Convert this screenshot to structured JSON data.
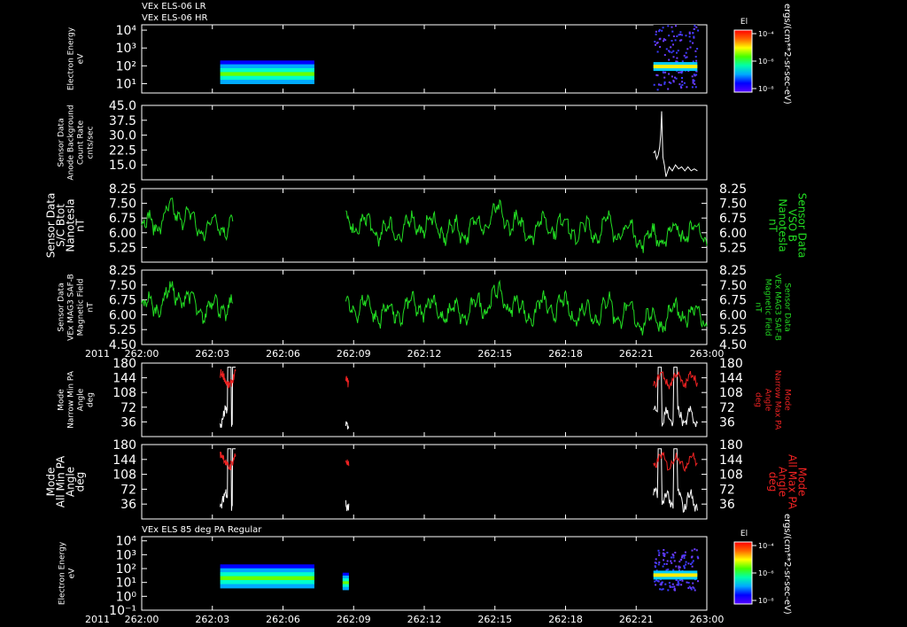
{
  "header": {
    "line1": "VEx ELS-06 LR",
    "line2": "VEx ELS-06 HR",
    "bottom_title": "VEx ELS 85 deg PA Regular"
  },
  "colors": {
    "white": "#ffffff",
    "green": "#22dd22",
    "red": "#ee2222",
    "background": "#000000"
  },
  "colorbars": [
    {
      "label": "El",
      "ticks": [
        "10⁻⁴",
        "10⁻⁶",
        "10⁻⁸"
      ],
      "unit": "ergs/(cm**2-sr-sec-eV)"
    },
    {
      "label": "El",
      "ticks": [
        "10⁻⁴",
        "10⁻⁶",
        "10⁻⁸"
      ],
      "unit": "ergs/(cm**2-sr-sec-eV)"
    }
  ],
  "chart_data": [
    {
      "type": "heatmap",
      "ylabel": [
        "Electron Energy",
        "eV"
      ],
      "y_scale": "log",
      "yticks": [
        "10⁴",
        "10³",
        "10²",
        "10¹"
      ],
      "ytick_values": [
        10000,
        1000,
        100,
        10
      ],
      "ylim": [
        3,
        20000
      ],
      "xlim": [
        0,
        180
      ],
      "blocks": [
        {
          "x": [
            25,
            55
          ],
          "energy": [
            10,
            200
          ],
          "level": "dense"
        },
        {
          "x": [
            163,
            177
          ],
          "energy": [
            5,
            20000
          ],
          "level": "sparse"
        }
      ]
    },
    {
      "type": "line",
      "ylabel": [
        "Sensor Data",
        "Anode Background",
        "Count Rate",
        "cnts/sec"
      ],
      "yticks": [
        "45.0",
        "37.5",
        "30.0",
        "22.5",
        "15.0"
      ],
      "ytick_values": [
        45,
        37.5,
        30,
        22.5,
        15
      ],
      "ylim": [
        7.5,
        45
      ],
      "xlim": [
        0,
        180
      ],
      "series": [
        {
          "color": "#ffffff",
          "x": [
            163.0,
            163.5,
            164.0,
            164.5,
            165.0,
            165.3,
            165.6,
            166.0,
            166.5,
            167.0,
            168.0,
            169.0,
            170.0,
            171.0,
            172.0,
            173.0,
            174.0,
            175.0,
            176.0,
            177.0
          ],
          "values": [
            21,
            22,
            18,
            20,
            24,
            30,
            42,
            19,
            15,
            9,
            14,
            12,
            15,
            13,
            14,
            12,
            14,
            12,
            13,
            12
          ]
        }
      ]
    },
    {
      "type": "line",
      "ylabel": [
        "Sensor Data",
        "S/C Btot",
        "Nanotesla",
        "nT"
      ],
      "ylabel_right": [
        "Sensor Data",
        "VSO B",
        "Nanotesla",
        "nT"
      ],
      "yticks": [
        "8.25",
        "7.50",
        "6.75",
        "6.00",
        "5.25"
      ],
      "ytick_values": [
        8.25,
        7.5,
        6.75,
        6.0,
        5.25
      ],
      "ylim": [
        4.5,
        8.25
      ],
      "xlim": [
        0,
        180
      ],
      "series": [
        {
          "color": "#22dd22",
          "generator": "mag",
          "segments": [
            [
              0,
              29
            ],
            [
              65,
              180
            ]
          ]
        }
      ]
    },
    {
      "type": "line",
      "ylabel": [
        "Sensor Data",
        "VEx MAG3 SAF-B",
        "Magnetic Field",
        "nT"
      ],
      "ylabel_right": [
        "Sensor Data",
        "VEx MAG3 SAF-B",
        "Magnetic Field",
        "nT"
      ],
      "yticks": [
        "8.25",
        "7.50",
        "6.75",
        "6.00",
        "5.25",
        "4.50"
      ],
      "ytick_values": [
        8.25,
        7.5,
        6.75,
        6.0,
        5.25,
        4.5
      ],
      "ylim": [
        4.5,
        8.25
      ],
      "xlim": [
        0,
        180
      ],
      "series": [
        {
          "color": "#22dd22",
          "generator": "mag",
          "segments": [
            [
              0,
              29
            ],
            [
              65,
              180
            ]
          ]
        }
      ]
    },
    {
      "type": "line",
      "ylabel": [
        "Mode",
        "Narrow Min PA",
        "Angle",
        "deg"
      ],
      "ylabel_right": [
        "Mode",
        "Narrow Max PA",
        "Angle",
        "deg"
      ],
      "yticks": [
        "180",
        "144",
        "108",
        "72",
        "36"
      ],
      "ytick_values": [
        180,
        144,
        108,
        72,
        36
      ],
      "ylim": [
        0,
        180
      ],
      "xlim": [
        0,
        180
      ],
      "series": [
        {
          "color": "#ffffff",
          "generator": "pa_min",
          "segments": [
            [
              25,
              30
            ],
            [
              65,
              66
            ],
            [
              163,
              177
            ]
          ]
        },
        {
          "color": "#ee2222",
          "generator": "pa_max",
          "segments": [
            [
              25,
              30
            ],
            [
              65,
              66
            ],
            [
              163,
              177
            ]
          ]
        }
      ]
    },
    {
      "type": "line",
      "ylabel": [
        "Mode",
        "All Min PA",
        "Angle",
        "deg"
      ],
      "ylabel_right": [
        "Mode",
        "All Max PA",
        "Angle",
        "deg"
      ],
      "yticks": [
        "180",
        "144",
        "108",
        "72",
        "36"
      ],
      "ytick_values": [
        180,
        144,
        108,
        72,
        36
      ],
      "ylim": [
        0,
        180
      ],
      "xlim": [
        0,
        180
      ],
      "series": [
        {
          "color": "#ffffff",
          "generator": "pa_min",
          "segments": [
            [
              25,
              30
            ],
            [
              65,
              66
            ],
            [
              163,
              177
            ]
          ]
        },
        {
          "color": "#ee2222",
          "generator": "pa_max",
          "segments": [
            [
              25,
              30
            ],
            [
              65,
              66
            ],
            [
              163,
              177
            ]
          ]
        }
      ]
    },
    {
      "type": "heatmap",
      "ylabel": [
        "Electron Energy",
        "eV"
      ],
      "y_scale": "log",
      "yticks": [
        "10⁴",
        "10³",
        "10²",
        "10¹",
        "10⁰",
        "10⁻¹"
      ],
      "ytick_values": [
        10000,
        1000,
        100,
        10,
        1,
        0.1
      ],
      "ylim": [
        0.1,
        20000
      ],
      "xlim": [
        0,
        180
      ],
      "blocks": [
        {
          "x": [
            25,
            55
          ],
          "energy": [
            4,
            200
          ],
          "level": "dense"
        },
        {
          "x": [
            64,
            66
          ],
          "energy": [
            3,
            50
          ],
          "level": "dense"
        },
        {
          "x": [
            163,
            177
          ],
          "energy": [
            3,
            3000
          ],
          "level": "sparse"
        }
      ]
    }
  ],
  "xaxis": {
    "year": "2011",
    "ticks": [
      "262:00",
      "262:03",
      "262:06",
      "262:09",
      "262:12",
      "262:15",
      "262:18",
      "262:21",
      "263:00"
    ],
    "tick_values": [
      0,
      22.5,
      45,
      67.5,
      90,
      112.5,
      135,
      157.5,
      180
    ]
  }
}
